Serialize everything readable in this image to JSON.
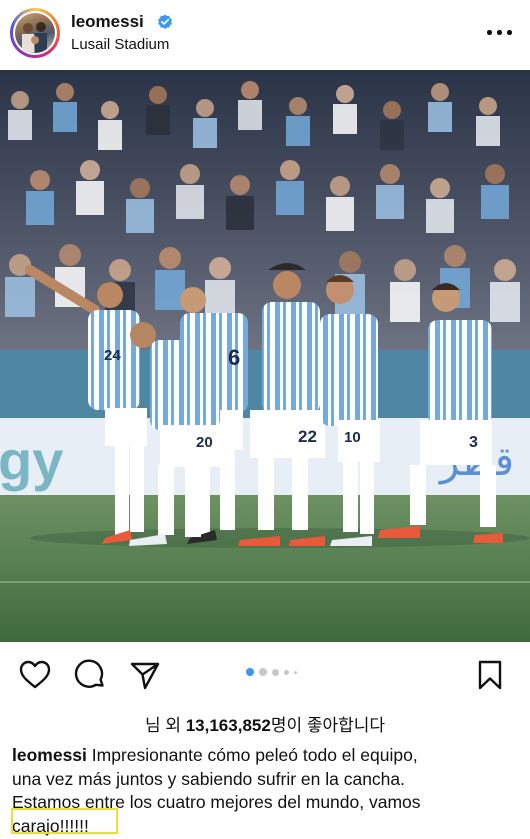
{
  "post": {
    "username": "leomessi",
    "verified": true,
    "location": "Lusail Stadium",
    "more_icon": "more-horizontal-icon"
  },
  "photo": {
    "banner_left": "gy",
    "banner_right": "قطر",
    "colors": {
      "sky_blue": "#75aadb",
      "pitch": "#4f7a4c",
      "banner": "#e8eef5"
    },
    "players": [
      {
        "number": "24"
      },
      {
        "number": "6"
      },
      {
        "number": "20"
      },
      {
        "number": "22"
      },
      {
        "number": "10"
      },
      {
        "number": "3"
      }
    ]
  },
  "actions": {
    "icons": [
      "heart-icon",
      "comment-icon",
      "share-icon",
      "bookmark-icon"
    ],
    "carousel": {
      "count": 5,
      "active": 0
    }
  },
  "likes": {
    "prefix": "님 외 ",
    "count": "13,163,852",
    "suffix": "명이 좋아합니다"
  },
  "caption": {
    "username": "leomessi",
    "line1": "Impresionante cómo peleó todo el equipo,",
    "line2": "una vez más juntos y sabiendo sufrir en la cancha.",
    "line3": "Estamos entre los cuatro mejores del mundo, vamos",
    "line4": "carajo!!!!!!"
  },
  "colors": {
    "text": "#111111",
    "highlight_box": "#ecdf3a",
    "verified_blue": "#3897f0"
  }
}
